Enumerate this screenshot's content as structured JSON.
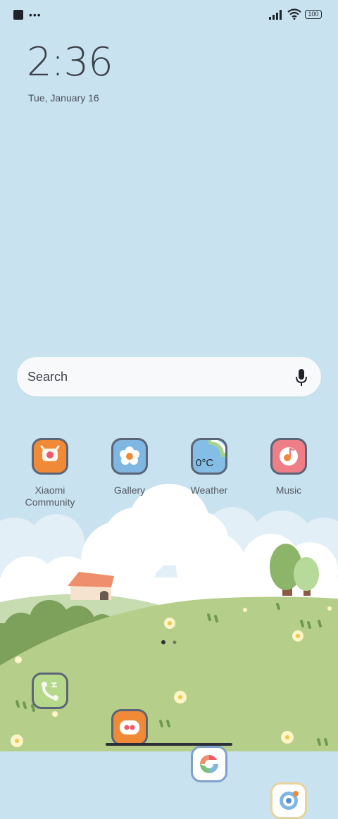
{
  "status_bar": {
    "left_icons": [
      "square-icon",
      "more-dots-icon"
    ],
    "right_icons": [
      "signal-icon",
      "wifi-icon",
      "battery-icon"
    ],
    "battery_level": "100"
  },
  "lockscreen": {
    "time": "2:36",
    "date": "Tue, January 16"
  },
  "search": {
    "label": "Search",
    "icon": "mic-icon"
  },
  "apps": [
    {
      "label": "Xiaomi\nCommunity",
      "icon": "xiaomi-community-icon",
      "color": "#f08a36"
    },
    {
      "label": "Gallery",
      "icon": "gallery-icon",
      "color": "#7fb6e2"
    },
    {
      "label": "Weather",
      "icon": "weather-icon",
      "color": "#84bde6",
      "temp": "0°C"
    },
    {
      "label": "Music",
      "icon": "music-icon",
      "color": "#ef7e86"
    }
  ],
  "pager": {
    "pages": 2,
    "current": 1
  },
  "dock": [
    {
      "icon": "phone-icon",
      "color": "#b6d88a"
    },
    {
      "icon": "messages-icon",
      "color": "#f08a36"
    },
    {
      "icon": "chrome-icon",
      "color": "#ffffff"
    },
    {
      "icon": "browser-icon",
      "color": "#ffffff"
    }
  ]
}
